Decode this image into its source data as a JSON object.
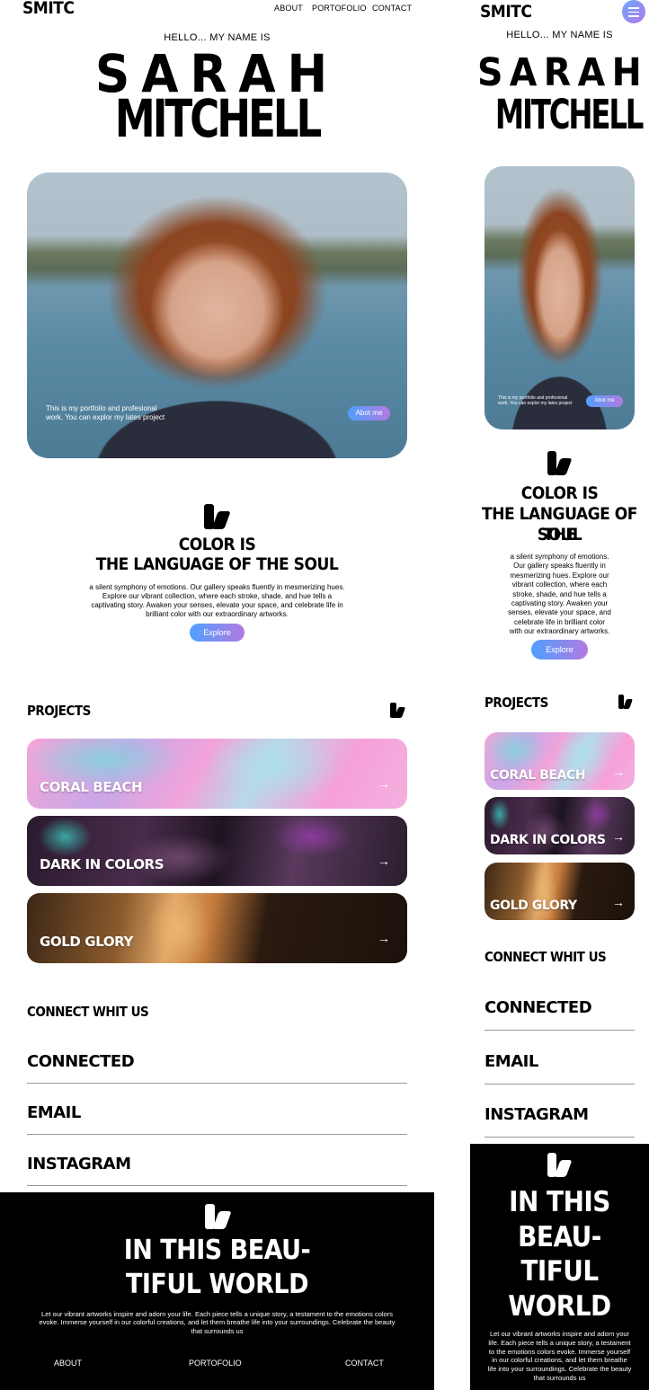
{
  "brand": "SMITC",
  "nav": {
    "about": "ABOUT",
    "portfolio": "PORTOFOLIO",
    "contact": "CONTACT"
  },
  "hero": {
    "hello": "HELLO... MY NAME IS",
    "first_name": "SARAH",
    "last_name": "MITCHELL",
    "caption_line1": "This is my portfolio and profesional",
    "caption_line2": "work. You can explor my lates project",
    "about_button": "Abot me"
  },
  "color_section": {
    "title_line1": "COLOR IS",
    "title_line2": "THE LANGUAGE OF THE SOUL",
    "mobile_title_line2": "THE LANGUAGE OF THE",
    "mobile_title_line3": "SOUL",
    "body_line1": "a silent symphony of emotions. Our gallery speaks fluently in mesmerizing hues.",
    "body_line2": "Explore our vibrant collection, where each stroke, shade, and hue tells a",
    "body_line3": "captivating story. Awaken your senses, elevate your space, and celebrate life in",
    "body_line4": "brilliant color with our extraordinary artworks.",
    "mobile_body": [
      "a silent symphony of emotions.",
      "Our gallery speaks fluently in",
      "mesmerizing hues. Explore our",
      "vibrant collection, where each",
      "stroke, shade, and hue tells a",
      "captivating story. Awaken your",
      "senses, elevate your space, and",
      "celebrate life in brilliant color",
      "with our extraordinary artworks."
    ],
    "explore_button": "Explore"
  },
  "projects": {
    "heading": "PROJECTS",
    "items": [
      {
        "label": "CORAL BEACH",
        "arrow": "→"
      },
      {
        "label": "DARK IN COLORS",
        "arrow": "→"
      },
      {
        "label": "GOLD GLORY",
        "arrow": "→"
      }
    ]
  },
  "connect": {
    "heading": "CONNECT WHIT US",
    "items": [
      "CONNECTED",
      "EMAIL",
      "INSTAGRAM"
    ]
  },
  "footer": {
    "title_line1": "IN THIS BEAU-",
    "title_line2": "TIFUL WORLD",
    "mobile_title": [
      "IN THIS",
      "BEAU-",
      "TIFUL",
      "WORLD"
    ],
    "body_line1": "Let our vibrant artworks inspire and adorn your life. Each piece tells a unique story, a testament to the emotions colors",
    "body_line2": "evoke. Immerse yourself in our colorful creations, and let them breathe life into your surroundings. Celebrate the beauty",
    "body_line3": "that surrounds us",
    "mobile_body": [
      "Let our vibrant artworks inspire and adorn your",
      "life. Each piece tells a unique story, a testament",
      "to the emotions colors evoke. Immerse yourself",
      "in our colorful creations, and let them breathe",
      "life into your surroundings. Celebrate the beauty",
      "that surrounds us"
    ],
    "links": {
      "about": "ABOUT",
      "portfolio": "PORTOFOLIO",
      "contact": "CONTACT"
    }
  },
  "colors": {
    "button_gradient_start": "#4fa0ff",
    "button_gradient_end": "#b27ae0",
    "footer_bg": "#000000"
  }
}
